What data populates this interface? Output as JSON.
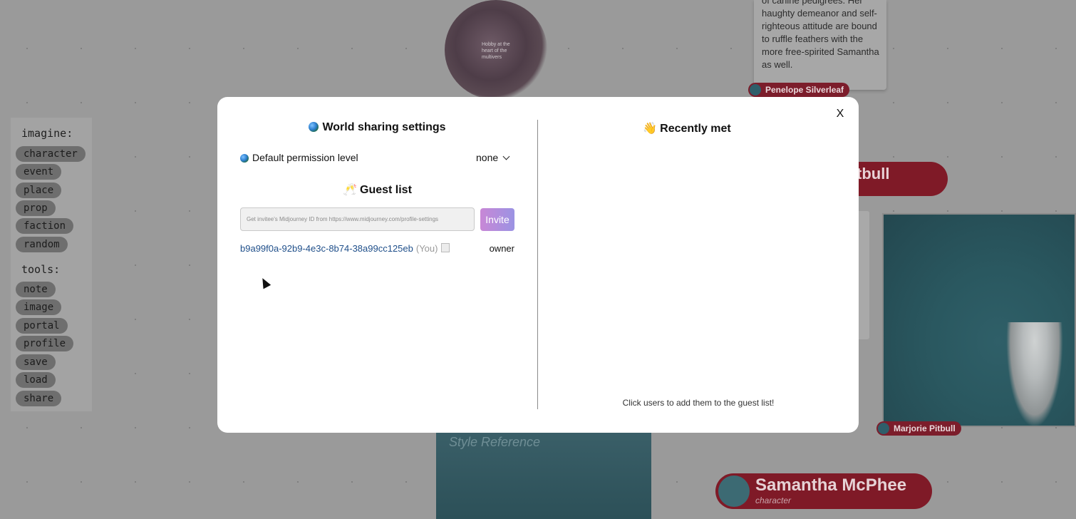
{
  "background": {
    "orb_text": "Hobby at the heart of the multivers",
    "note_text": "of canine pedigrees. Her haughty demeanor and self-righteous attitude are bound to ruffle feathers with the more free-spirited Samantha as well.",
    "tags": {
      "penelope": "Penelope Silverleaf",
      "marjorie": "Marjorie Pitbull"
    },
    "pitbull_banner": "tbull",
    "style_reference": "Style Reference",
    "samantha": {
      "name": "Samantha McPhee",
      "type": "character"
    }
  },
  "toolbar": {
    "imagine_label": "imagine:",
    "imagine_items": [
      "character",
      "event",
      "place",
      "prop",
      "faction",
      "random"
    ],
    "tools_label": "tools:",
    "tools_items": [
      "note",
      "image",
      "portal",
      "profile",
      "save",
      "load",
      "share"
    ]
  },
  "modal": {
    "close_label": "X",
    "left": {
      "title": "World sharing settings",
      "permission_label": "Default permission level",
      "permission_value": "none",
      "guest_list_title": "Guest list",
      "invite_placeholder": "Get invitee's Midjourney ID from https://www.midjourney.com/profile-settings",
      "invite_button": "Invite",
      "guests": [
        {
          "id": "b9a99f0a-92b9-4e3c-8b74-38a99cc125eb",
          "you_label": "(You)",
          "role": "owner"
        }
      ]
    },
    "right": {
      "title": "Recently met",
      "hint": "Click users to add them to the guest list!"
    }
  },
  "colors": {
    "overlay": "#9a9a9a",
    "invite_gradient_start": "#c887d6",
    "invite_gradient_end": "#9b93e3",
    "guest_id": "#1f4f8a",
    "banner_red": "#7f1a27"
  }
}
